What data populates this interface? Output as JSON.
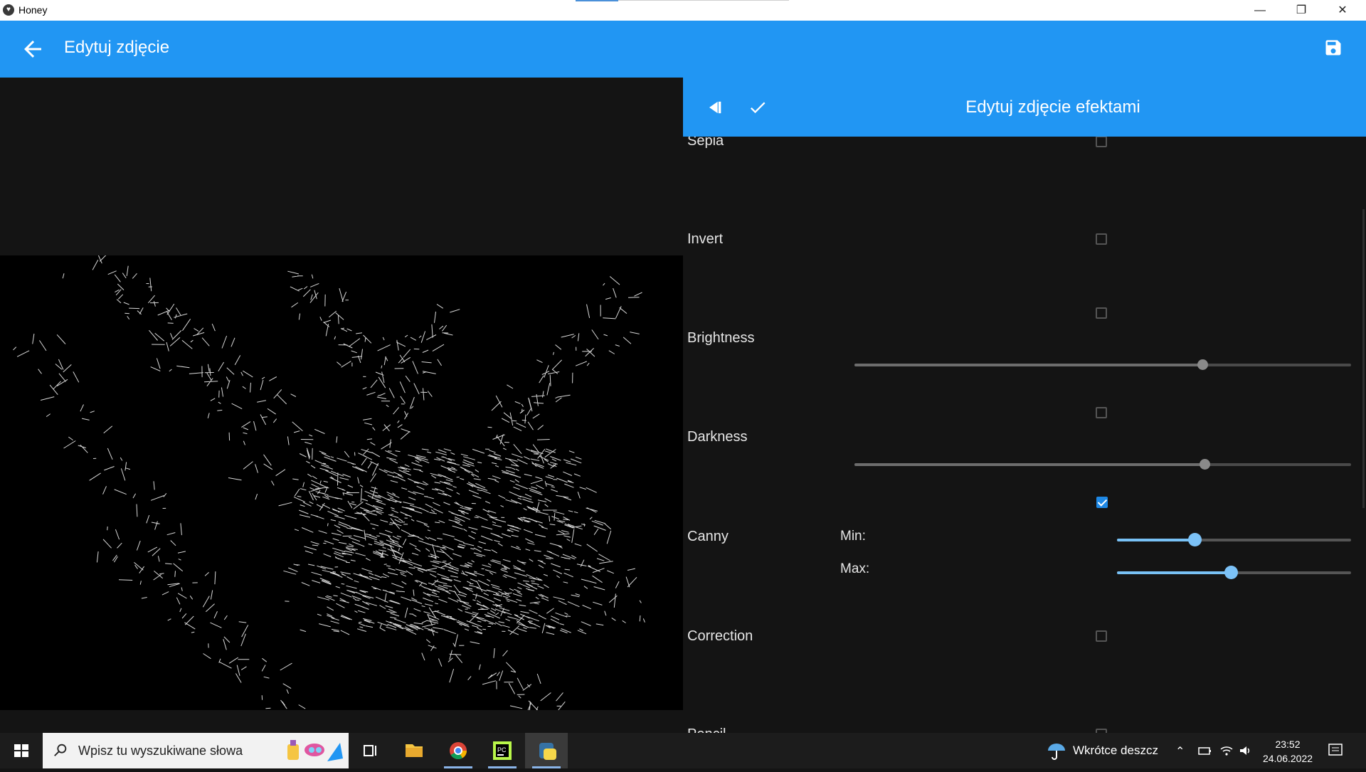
{
  "window": {
    "title": "Honey"
  },
  "appbar": {
    "title": "Edytuj zdjęcie"
  },
  "panel": {
    "title": "Edytuj zdjęcie efektami",
    "effects": [
      {
        "label": "Sepia",
        "checked": false
      },
      {
        "label": "Invert",
        "checked": false
      },
      {
        "label": "Brightness",
        "checked": false,
        "slider": 0.7
      },
      {
        "label": "Darkness",
        "checked": false,
        "slider": 0.705
      },
      {
        "label": "Canny",
        "checked": true,
        "min_label": "Min:",
        "max_label": "Max:",
        "min": 0.33,
        "max": 0.485
      },
      {
        "label": "Correction",
        "checked": false
      },
      {
        "label": "Pencil",
        "checked": false
      }
    ]
  },
  "taskbar": {
    "search_placeholder": "Wpisz tu wyszukiwane słowa",
    "weather": "Wkrótce deszcz",
    "time": "23:52",
    "date": "24.06.2022"
  },
  "colors": {
    "accent": "#2196f3",
    "background": "#141414",
    "slider_active": "#78c1f5"
  }
}
